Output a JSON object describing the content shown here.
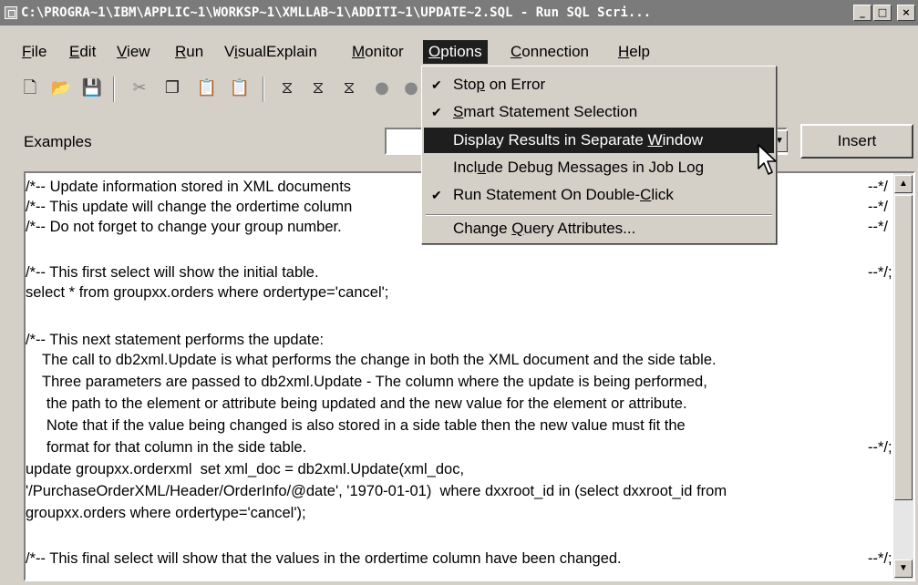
{
  "window": {
    "title": "C:\\PROGRA~1\\IBM\\APPLIC~1\\WORKSP~1\\XMLLAB~1\\ADDITI~1\\UPDATE~2.SQL - Run SQL Scri...",
    "minimize_label": "_",
    "maximize_label": "□",
    "close_label": "×"
  },
  "menubar": {
    "file": {
      "ul": "F",
      "rest": "ile"
    },
    "edit": {
      "ul": "E",
      "rest": "dit"
    },
    "view": {
      "ul": "V",
      "rest": "iew"
    },
    "run": {
      "ul": "R",
      "rest": "un"
    },
    "visualexplain": {
      "pre": "V",
      "ul": "i",
      "rest": "sualExplain"
    },
    "monitor": {
      "ul": "M",
      "rest": "onitor"
    },
    "options": {
      "ul": "O",
      "rest": "ptions"
    },
    "connection": {
      "ul": "C",
      "rest": "onnection"
    },
    "help": {
      "ul": "H",
      "rest": "elp"
    }
  },
  "toolbar": {
    "icons": [
      "new-document-icon",
      "open-folder-icon",
      "save-icon",
      "cut-icon",
      "copy-icon",
      "paste-icon",
      "paste-disabled-icon",
      "run-all-icon",
      "run-selected-icon",
      "run-from-cursor-icon",
      "stop-icon"
    ]
  },
  "examples": {
    "label": "Examples",
    "value": "",
    "insert_label": "Insert"
  },
  "options_menu": {
    "items": [
      {
        "checked": "✔",
        "pre": "Sto",
        "ul": "p",
        "post": " on Error"
      },
      {
        "checked": "✔",
        "pre": "",
        "ul": "S",
        "post": "mart Statement Selection"
      },
      {
        "checked": "",
        "pre": "Display Results in Separate ",
        "ul": "W",
        "post": "indow"
      },
      {
        "checked": "",
        "pre": "Incl",
        "ul": "u",
        "post": "de Debug Messages in Job Log"
      },
      {
        "checked": "✔",
        "pre": "Run Statement On Double-",
        "ul": "C",
        "post": "lick"
      },
      {
        "checked": "",
        "pre": "Change ",
        "ul": "Q",
        "post": "uery Attributes..."
      }
    ]
  },
  "editor": {
    "lines": [
      "/*-- Update information stored in XML documents",
      "/*-- This update will change the ordertime column",
      "/*-- Do not forget to change your group number.",
      "",
      "/*-- This first select will show the initial table.",
      "select * from groupxx.orders where ordertype='cancel';",
      "",
      "/*-- This next statement performs the update:",
      "    The call to db2xml.Update is what performs the change in both the XML document and the side table.",
      "    Three parameters are passed to db2xml.Update - The column where the update is being performed,",
      "     the path to the element or attribute being updated and the new value for the element or attribute.",
      "     Note that if the value being changed is also stored in a side table then the new value must fit the",
      "     format for that column in the side table.",
      "update groupxx.orderxml  set xml_doc = db2xml.Update(xml_doc,",
      "'/PurchaseOrderXML/Header/OrderInfo/@date', '1970-01-01)  where dxxroot_id in (select dxxroot_id from",
      "groupxx.orders where ordertype='cancel');",
      "",
      "/*-- This final select will show that the values in the ordertime column have been changed."
    ],
    "right_marks": [
      "--*/",
      "--*/",
      "--*/",
      "",
      "--*/;",
      "",
      "",
      "",
      "",
      "",
      "",
      "",
      "--*/;",
      "",
      "",
      "",
      "",
      "--*/;"
    ]
  }
}
